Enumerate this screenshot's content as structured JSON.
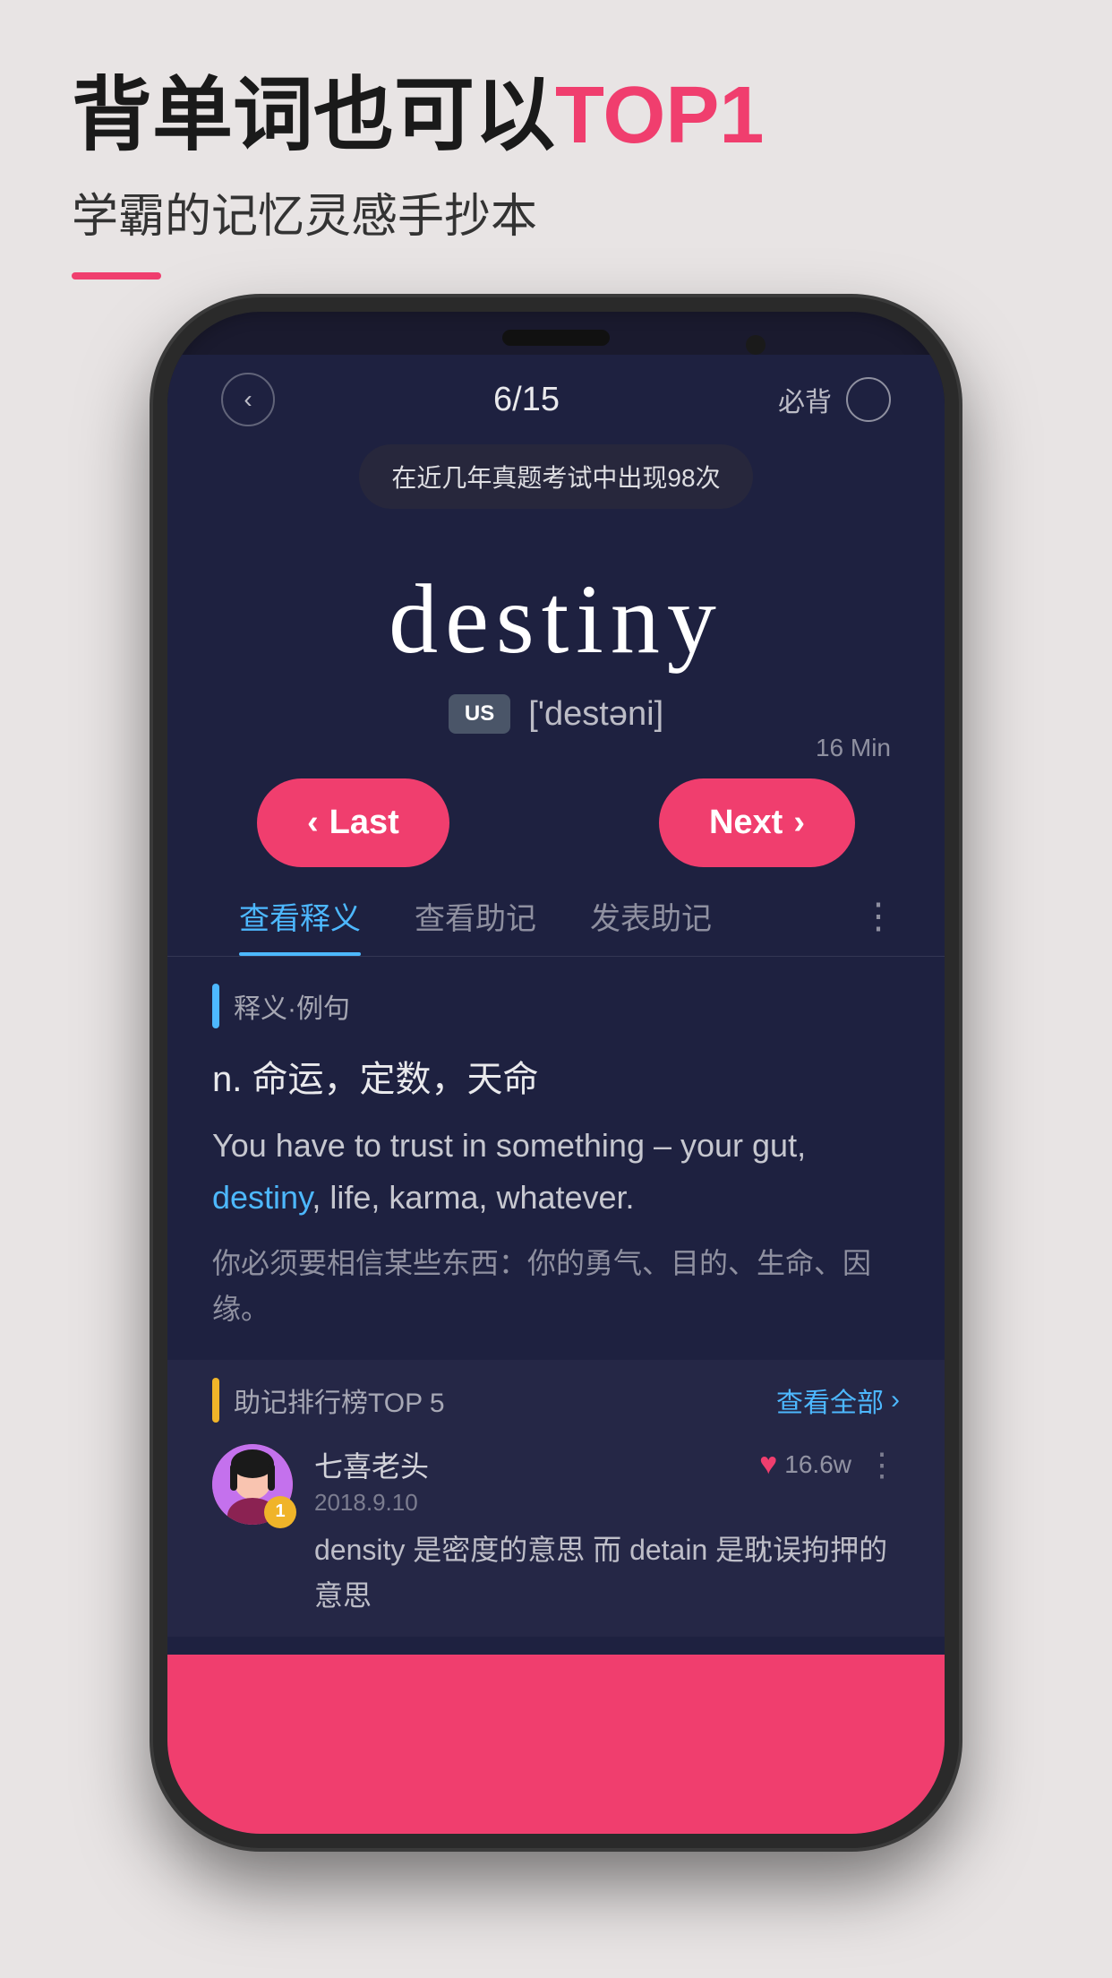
{
  "page": {
    "background_color": "#e8e4e4",
    "headline": {
      "prefix": "背单词也可以",
      "highlight": "TOP1"
    },
    "subheadline": "学霸的记忆灵感手抄本"
  },
  "phone": {
    "status": {
      "back_btn": "‹",
      "progress": "6/15",
      "must_memorize_label": "必背",
      "tooltip": "在近几年真题考试中出现98次"
    },
    "word": {
      "text": "destiny",
      "us_label": "US",
      "phonetic": "['destəni]"
    },
    "navigation": {
      "time_hint": "16 Min",
      "last_label": "‹ Last",
      "next_label": "Next ›"
    },
    "tabs": [
      {
        "label": "查看释义",
        "active": true
      },
      {
        "label": "查看助记",
        "active": false
      },
      {
        "label": "发表助记",
        "active": false
      }
    ],
    "definition": {
      "section_label": "释义·例句",
      "pos": "n.  命运，定数，天命",
      "example_en_before": "You have to trust in something –\nyour gut, ",
      "example_highlight": "destiny",
      "example_en_after": ", life, karma, whatever.",
      "example_zh": "你必须要相信某些东西：你的勇气、目的、生命、因缘。"
    },
    "mnemonic": {
      "section_label": "助记排行榜TOP 5",
      "see_all": "查看全部",
      "items": [
        {
          "username": "七喜老头",
          "date": "2018.9.10",
          "rank": "1",
          "like_count": "16.6w",
          "text": "density 是密度的意思  而 detain 是耽误拘押的意思"
        }
      ]
    }
  }
}
